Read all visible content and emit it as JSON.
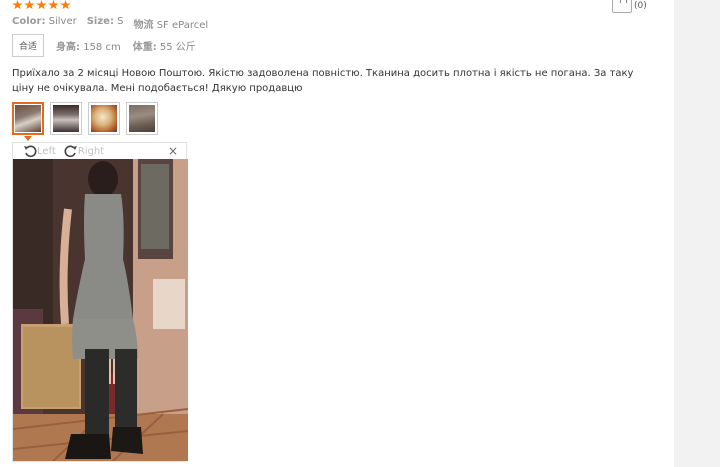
{
  "review": {
    "rating": 5,
    "color_label": "Color:",
    "color_value": "Silver",
    "size_label": "Size:",
    "size_value": "S",
    "shipping_label": "物流",
    "shipping_value": "SF eParcel",
    "fit_badge": "合适",
    "height_label": "身高:",
    "height_value": "158 cm",
    "weight_label": "体重:",
    "weight_value": "55 公斤",
    "text": "Приїхало за 2 місяці Новою Поштою. Якістю задоволена повністю. Тканина досить плотна і якість не погана. За таку ціну не очікувала. Мені подобається! Дякую продавцю",
    "helpful_count": "(0)",
    "thumbnail_count": 4,
    "active_thumbnail": 1
  },
  "viewer": {
    "rotate_left_label": "Left",
    "rotate_right_label": "Right",
    "close_symbol": "×"
  },
  "icons": {
    "star": "star-icon",
    "helpful": "thumbs-up-icon",
    "rotate_left": "rotate-left-icon",
    "rotate_right": "rotate-right-icon",
    "close": "close-icon"
  },
  "colors": {
    "star": "#ff7a00",
    "active_thumb_border": "#e56b1f"
  }
}
